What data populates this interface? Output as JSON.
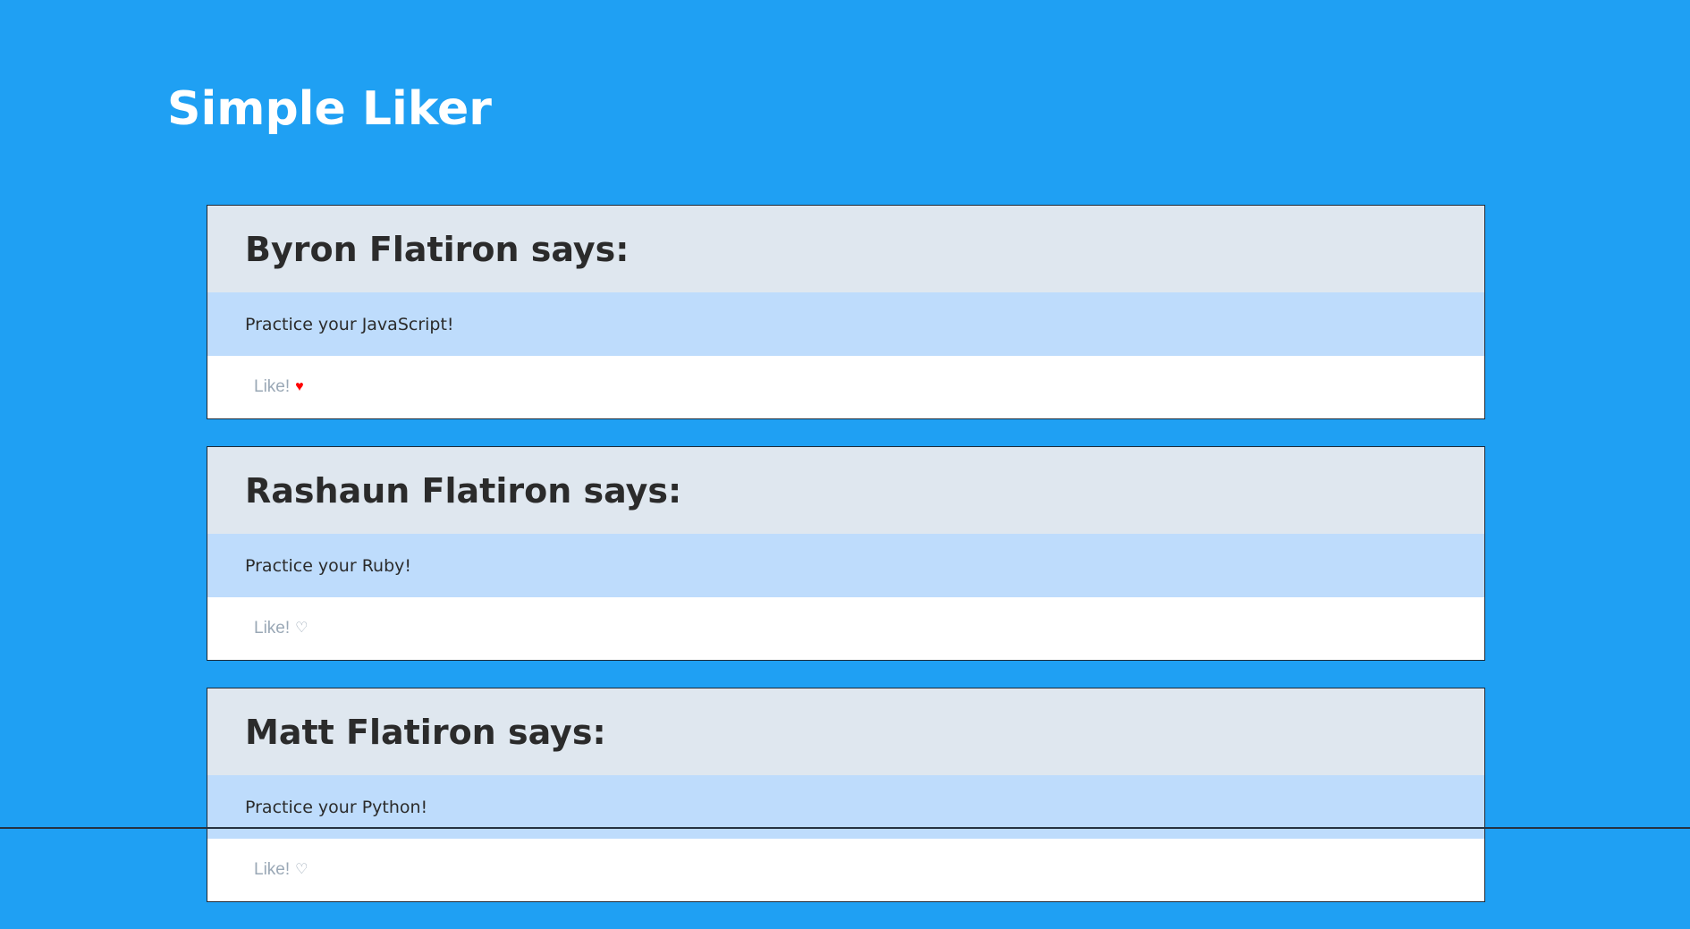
{
  "app": {
    "title": "Simple Liker"
  },
  "posts": [
    {
      "author": "Byron Flatiron says:",
      "message": "Practice your JavaScript!",
      "like_label": "Like!",
      "liked": true,
      "heart_glyph": "♥"
    },
    {
      "author": "Rashaun Flatiron says:",
      "message": "Practice your Ruby!",
      "like_label": "Like!",
      "liked": false,
      "heart_glyph": "♡"
    },
    {
      "author": "Matt Flatiron says:",
      "message": "Practice your Python!",
      "like_label": "Like!",
      "liked": false,
      "heart_glyph": "♡"
    }
  ],
  "colors": {
    "page_background": "#1fa0f3",
    "header_background": "#dfe7ef",
    "body_background": "#bedcfc",
    "liked_heart": "#ff0000"
  }
}
